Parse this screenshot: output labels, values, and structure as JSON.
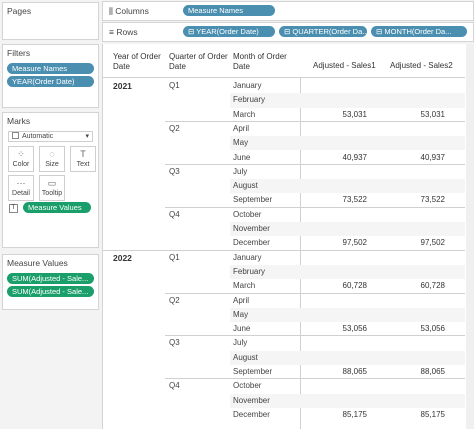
{
  "panels": {
    "pages": "Pages",
    "filters": "Filters",
    "marks": "Marks",
    "measure_values": "Measure Values"
  },
  "filters": [
    "Measure Names",
    "YEAR(Order Date)"
  ],
  "marks": {
    "type": "Automatic",
    "buttons": [
      "Color",
      "Size",
      "Text",
      "Detail",
      "Tooltip"
    ],
    "pill": "Measure Values"
  },
  "measure_values": [
    "SUM(Adjusted - Sale...",
    "SUM(Adjusted - Sale..."
  ],
  "shelves": {
    "columns_label": "Columns",
    "columns": [
      "Measure Names"
    ],
    "rows_label": "Rows",
    "rows": [
      "YEAR(Order Date)",
      "QUARTER(Order Da...",
      "MONTH(Order Da..."
    ]
  },
  "table": {
    "headers": {
      "year": "Year of Order Date",
      "quarter": "Quarter of Order Date",
      "month": "Month of Order Date",
      "sales1": "Adjusted - Sales1",
      "sales2": "Adjusted - Sales2"
    },
    "years": [
      {
        "year": "2021",
        "quarters": [
          {
            "q": "Q1",
            "months": [
              [
                "January",
                "",
                ""
              ],
              [
                "February",
                "",
                ""
              ],
              [
                "March",
                "53,031",
                "53,031"
              ]
            ]
          },
          {
            "q": "Q2",
            "months": [
              [
                "April",
                "",
                ""
              ],
              [
                "May",
                "",
                ""
              ],
              [
                "June",
                "40,937",
                "40,937"
              ]
            ]
          },
          {
            "q": "Q3",
            "months": [
              [
                "July",
                "",
                ""
              ],
              [
                "August",
                "",
                ""
              ],
              [
                "September",
                "73,522",
                "73,522"
              ]
            ]
          },
          {
            "q": "Q4",
            "months": [
              [
                "October",
                "",
                ""
              ],
              [
                "November",
                "",
                ""
              ],
              [
                "December",
                "97,502",
                "97,502"
              ]
            ]
          }
        ]
      },
      {
        "year": "2022",
        "quarters": [
          {
            "q": "Q1",
            "months": [
              [
                "January",
                "",
                ""
              ],
              [
                "February",
                "",
                ""
              ],
              [
                "March",
                "60,728",
                "60,728"
              ]
            ]
          },
          {
            "q": "Q2",
            "months": [
              [
                "April",
                "",
                ""
              ],
              [
                "May",
                "",
                ""
              ],
              [
                "June",
                "53,056",
                "53,056"
              ]
            ]
          },
          {
            "q": "Q3",
            "months": [
              [
                "July",
                "",
                ""
              ],
              [
                "August",
                "",
                ""
              ],
              [
                "September",
                "88,065",
                "88,065"
              ]
            ]
          },
          {
            "q": "Q4",
            "months": [
              [
                "October",
                "",
                ""
              ],
              [
                "November",
                "",
                ""
              ],
              [
                "December",
                "85,175",
                "85,175"
              ]
            ]
          }
        ]
      }
    ]
  },
  "colors": {
    "blue_pill": "#4a8fb0",
    "green_pill": "#1a9f6b"
  }
}
